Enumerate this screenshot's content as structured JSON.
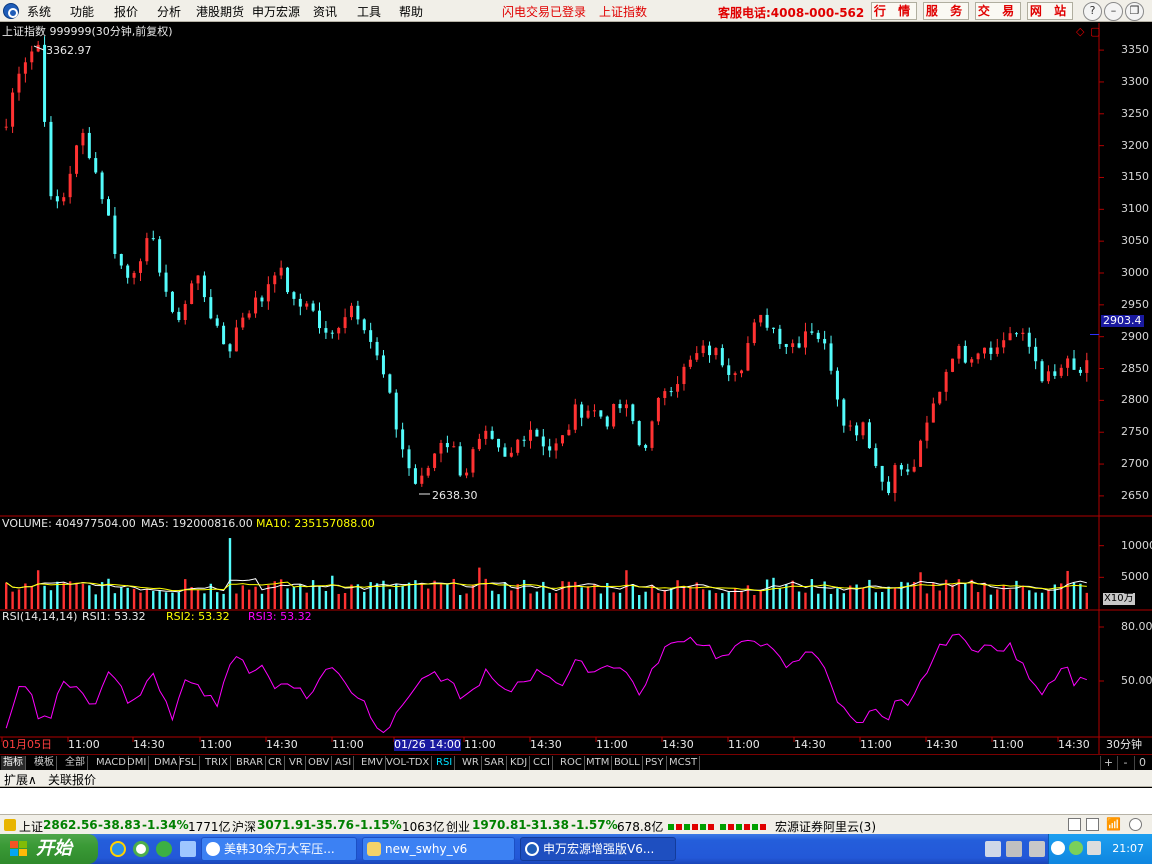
{
  "menu": {
    "items": [
      "系统",
      "功能",
      "报价",
      "分析",
      "港股期货",
      "申万宏源",
      "资讯",
      "工具",
      "帮助"
    ],
    "flash_status": "闪电交易已登录",
    "current_index": "上证指数",
    "service_phone": "客服电话:4008-000-562",
    "quick_buttons": [
      "行 情",
      "服 务",
      "交 易",
      "网 站"
    ]
  },
  "chart_header": {
    "title": "上证指数 999999(30分钟,前复权)",
    "high_label": "3362.97",
    "low_label": "2638.30",
    "last_price": "2903.4"
  },
  "volume_header": {
    "volume": "VOLUME: 404977504.00",
    "ma5": "MA5: 192000816.00",
    "ma10": "MA10: 235157088.00",
    "unit": "X10万"
  },
  "rsi_header": {
    "name": "RSI(14,14,14)",
    "rsi1": "RSI1: 53.32",
    "rsi2": "RSI2: 53.32",
    "rsi3": "RSI3: 53.32"
  },
  "time_axis": {
    "labels": [
      "01月05日",
      "11:00",
      "14:30",
      "11:00",
      "14:30",
      "11:00",
      "01/26 14:00",
      "11:00",
      "14:30",
      "11:00",
      "14:30",
      "11:00",
      "14:30",
      "11:00",
      "14:30",
      "11:00",
      "14:30"
    ],
    "period": "30分钟"
  },
  "indicator_tabs": [
    "指标",
    "模板",
    "全部",
    "MACD",
    "DMI",
    "DMA",
    "FSL",
    "TRIX",
    "BRAR",
    "CR",
    "VR",
    "OBV",
    "ASI",
    "EMV",
    "VOL-TDX",
    "RSI",
    "WR",
    "SAR",
    "KDJ",
    "CCI",
    "ROC",
    "MTM",
    "BOLL",
    "PSY",
    "MCST"
  ],
  "indicator_active": "RSI",
  "tab_controls": [
    "+",
    "-",
    "0"
  ],
  "expand_row": [
    "扩展∧",
    "关联报价"
  ],
  "status": {
    "sh_label": "上证",
    "sh_value": "2862.56",
    "sh_change": "-38.83",
    "sh_pct": "-1.34%",
    "sh_amount": "1771亿",
    "hs_label": "沪深",
    "hs_value": "3071.91",
    "hs_change": "-35.76",
    "hs_pct": "-1.15%",
    "hs_amount": "1063亿",
    "cy_label": "创业",
    "cy_value": "1970.81",
    "cy_change": "-31.38",
    "cy_pct": "-1.57%",
    "cy_amount": "678.8亿",
    "broker": "宏源证券阿里云(3)"
  },
  "taskbar": {
    "start": "开始",
    "tasks": [
      "美韩30余万大军压...",
      "new_swhy_v6",
      "申万宏源增强版V6..."
    ],
    "clock": "21:07"
  },
  "colors": {
    "up": "#ff3232",
    "down": "#54fcfc",
    "ma5": "#ffffff",
    "ma10": "#ffff00",
    "rsi": "#ff00ff",
    "axis": "#b00000"
  },
  "chart_data": [
    {
      "type": "candlestick",
      "title": "上证指数 999999(30分钟,前复权)",
      "ylim": [
        2620,
        3380
      ],
      "y_ticks": [
        2650,
        2700,
        2750,
        2800,
        2850,
        2900,
        2950,
        3000,
        3050,
        3100,
        3150,
        3200,
        3250,
        3300,
        3350
      ],
      "high": 3362.97,
      "low": 2638.3,
      "last": 2903.4,
      "close_trend": [
        3230,
        3320,
        3345,
        3360,
        3110,
        3110,
        3180,
        3220,
        3160,
        3100,
        3020,
        2990,
        3030,
        3050,
        3000,
        2920,
        2950,
        3000,
        2960,
        2900,
        2880,
        2930,
        2950,
        2960,
        3010,
        2990,
        2940,
        2960,
        2920,
        2890,
        2930,
        2950,
        2930,
        2880,
        2830,
        2760,
        2700,
        2660,
        2700,
        2740,
        2730,
        2680,
        2720,
        2740,
        2720,
        2700,
        2740,
        2760,
        2740,
        2720,
        2740,
        2780,
        2790,
        2780,
        2770,
        2790,
        2780,
        2720,
        2760,
        2820,
        2830,
        2850,
        2870,
        2880,
        2870,
        2850,
        2860,
        2910,
        2930,
        2910,
        2890,
        2890,
        2920,
        2900,
        2860,
        2780,
        2750,
        2770,
        2700,
        2660,
        2700,
        2680,
        2720,
        2780,
        2830,
        2880,
        2870,
        2880,
        2890,
        2880,
        2910,
        2900,
        2880,
        2840,
        2830,
        2860,
        2840,
        2850
      ]
    },
    {
      "type": "bar",
      "title": "VOLUME",
      "y_ticks": [
        5000,
        10000
      ],
      "unit": "X10万",
      "ylim": [
        0,
        12000
      ]
    },
    {
      "type": "line",
      "title": "RSI(14,14,14)",
      "y_ticks": [
        50,
        80
      ],
      "ylim": [
        20,
        85
      ],
      "rsi_trend": [
        22,
        45,
        48,
        28,
        30,
        50,
        48,
        40,
        35,
        55,
        52,
        38,
        42,
        55,
        40,
        30,
        48,
        52,
        42,
        38,
        60,
        62,
        55,
        60,
        45,
        50,
        48,
        40,
        50,
        58,
        55,
        44,
        40,
        28,
        22,
        30,
        42,
        48,
        55,
        50,
        48,
        40,
        45,
        55,
        48,
        42,
        50,
        52,
        56,
        52,
        48,
        60,
        58,
        55,
        60,
        58,
        52,
        42,
        55,
        68,
        70,
        75,
        72,
        70,
        62,
        65,
        70,
        75,
        70,
        65,
        58,
        60,
        70,
        62,
        48,
        35,
        30,
        28,
        35,
        25,
        40,
        34,
        48,
        60,
        70,
        76,
        72,
        68,
        70,
        66,
        70,
        60,
        52,
        44,
        52,
        60,
        48,
        53
      ]
    }
  ]
}
